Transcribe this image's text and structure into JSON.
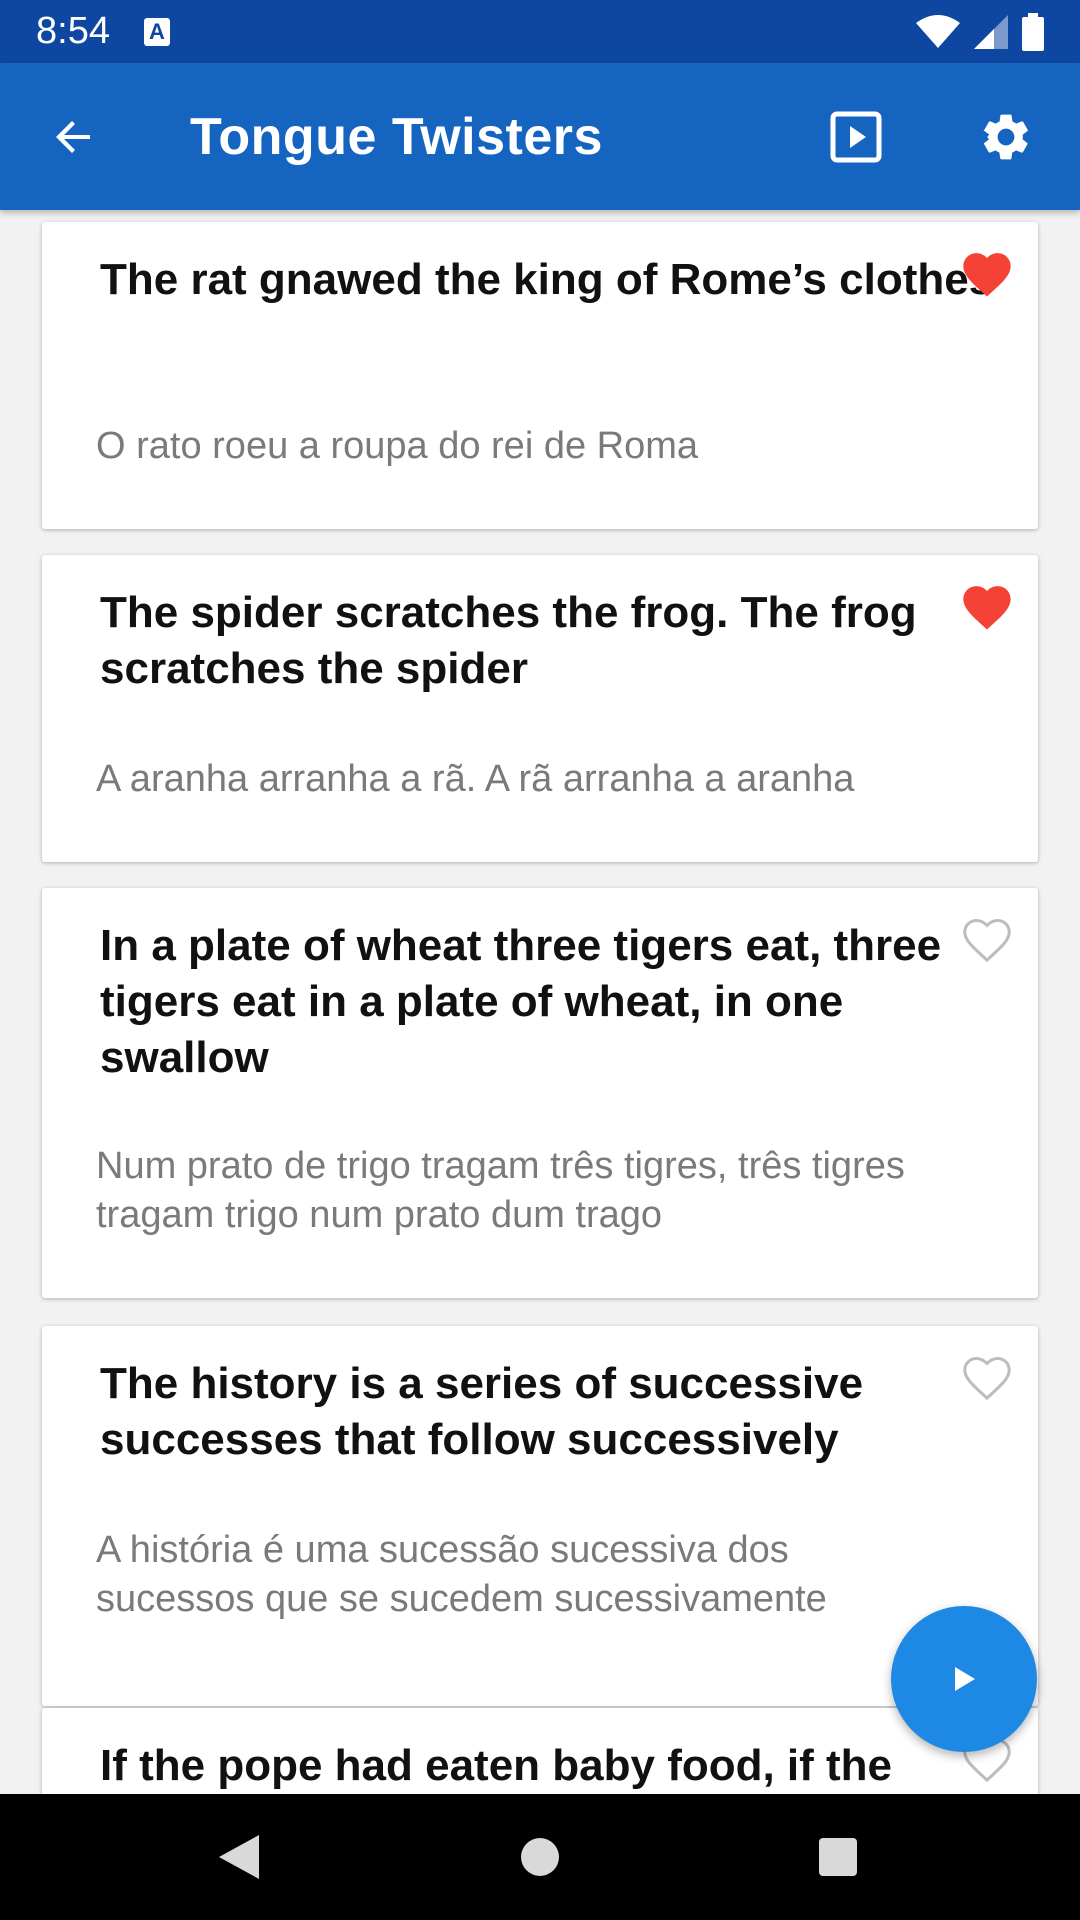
{
  "status_bar": {
    "time": "8:54",
    "notification_icon": "a-icon"
  },
  "app_bar": {
    "title": "Tongue Twisters"
  },
  "items": [
    {
      "title": "The rat gnawed the king of Rome’s clothes",
      "translation": "O rato roeu a roupa do rei de Roma",
      "favorite": true
    },
    {
      "title": "The spider scratches the frog. The frog scratches the spider",
      "translation": "A aranha arranha a rã. A rã arranha a aranha",
      "favorite": true
    },
    {
      "title": "In a plate of wheat three tigers eat, three tigers eat in a plate of wheat, in one swallow",
      "translation": "Num prato de trigo tragam três tigres, três tigres tragam trigo num prato dum trago",
      "favorite": false
    },
    {
      "title": "The history is a series of successive successes that follow successively",
      "translation": "A história é uma sucessão sucessiva dos sucessos que se sucedem sucessivamente",
      "favorite": false
    },
    {
      "title": "If the pope had eaten baby food, if the",
      "translation": "",
      "favorite": false
    }
  ],
  "colors": {
    "status_bar": "#0d47a1",
    "app_bar": "#1565c0",
    "fab": "#1e88e5",
    "favorite": "#f44336",
    "unfavorite": "#bdbdbd"
  }
}
